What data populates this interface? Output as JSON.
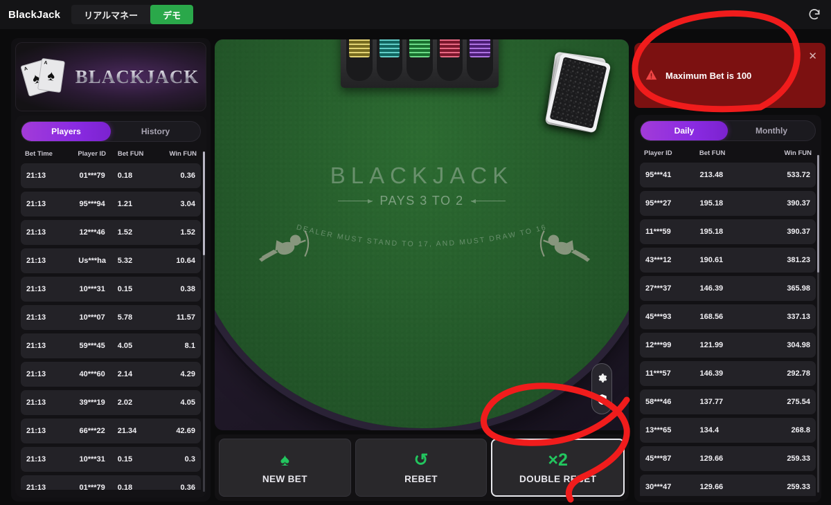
{
  "topbar": {
    "brand": "BlackJack",
    "mode_real_label": "リアルマネー",
    "mode_demo_label": "デモ",
    "refresh_icon": "refresh-icon"
  },
  "logo": {
    "word_black": "B",
    "word_black_rest": "LACK",
    "word_jack": "J",
    "word_jack_rest": "ACK",
    "full": "BLACKJACK"
  },
  "alert": {
    "message": "Maximum Bet is 100",
    "warning_icon": "warning-triangle-icon",
    "close_icon": "close-icon",
    "bg_color": "#7c1111"
  },
  "players_panel": {
    "tabs": [
      {
        "label": "Players",
        "active": true
      },
      {
        "label": "History",
        "active": false
      }
    ],
    "columns": [
      "Bet Time",
      "Player ID",
      "Bet FUN",
      "Win FUN"
    ],
    "rows": [
      {
        "time": "21:13",
        "player": "01***79",
        "bet": "0.18",
        "win": "0.36"
      },
      {
        "time": "21:13",
        "player": "95***94",
        "bet": "1.21",
        "win": "3.04"
      },
      {
        "time": "21:13",
        "player": "12***46",
        "bet": "1.52",
        "win": "1.52"
      },
      {
        "time": "21:13",
        "player": "Us***ha",
        "bet": "5.32",
        "win": "10.64"
      },
      {
        "time": "21:13",
        "player": "10***31",
        "bet": "0.15",
        "win": "0.38"
      },
      {
        "time": "21:13",
        "player": "10***07",
        "bet": "5.78",
        "win": "11.57"
      },
      {
        "time": "21:13",
        "player": "59***45",
        "bet": "4.05",
        "win": "8.1"
      },
      {
        "time": "21:13",
        "player": "40***60",
        "bet": "2.14",
        "win": "4.29"
      },
      {
        "time": "21:13",
        "player": "39***19",
        "bet": "2.02",
        "win": "4.05"
      },
      {
        "time": "21:13",
        "player": "66***22",
        "bet": "21.34",
        "win": "42.69"
      },
      {
        "time": "21:13",
        "player": "10***31",
        "bet": "0.15",
        "win": "0.3"
      },
      {
        "time": "21:13",
        "player": "01***79",
        "bet": "0.18",
        "win": "0.36"
      }
    ]
  },
  "leaderboard_panel": {
    "tabs": [
      {
        "label": "Daily",
        "active": true
      },
      {
        "label": "Monthly",
        "active": false
      }
    ],
    "columns": [
      "Player ID",
      "Bet FUN",
      "Win FUN"
    ],
    "rows": [
      {
        "player": "95***41",
        "bet": "213.48",
        "win": "533.72"
      },
      {
        "player": "95***27",
        "bet": "195.18",
        "win": "390.37"
      },
      {
        "player": "11***59",
        "bet": "195.18",
        "win": "390.37"
      },
      {
        "player": "43***12",
        "bet": "190.61",
        "win": "381.23"
      },
      {
        "player": "27***37",
        "bet": "146.39",
        "win": "365.98"
      },
      {
        "player": "45***93",
        "bet": "168.56",
        "win": "337.13"
      },
      {
        "player": "12***99",
        "bet": "121.99",
        "win": "304.98"
      },
      {
        "player": "11***57",
        "bet": "146.39",
        "win": "292.78"
      },
      {
        "player": "58***46",
        "bet": "137.77",
        "win": "275.54"
      },
      {
        "player": "13***65",
        "bet": "134.4",
        "win": "268.8"
      },
      {
        "player": "45***87",
        "bet": "129.66",
        "win": "259.33"
      },
      {
        "player": "30***47",
        "bet": "129.66",
        "win": "259.33"
      }
    ]
  },
  "table": {
    "title": "BLACKJACK",
    "pays": "PAYS 3 TO 2",
    "rule": "DEALER MUST STAND TO 17, AND MUST DRAW TO 16",
    "felt_color": "#2a6430",
    "chip_colors": [
      "#d8c23a",
      "#1fb9b0",
      "#2ecc55",
      "#e0294f",
      "#8b37d6"
    ]
  },
  "side_controls": {
    "settings_icon": "gear-icon",
    "verified_icon": "shield-check-icon"
  },
  "actions": [
    {
      "glyph": "♠",
      "glyph_name": "spade-icon",
      "label": "NEW BET",
      "selected": false
    },
    {
      "glyph": "↺",
      "glyph_name": "refresh-icon",
      "label": "REBET",
      "selected": false
    },
    {
      "glyph": "×2",
      "glyph_name": "multiply-two-icon",
      "label": "DOUBLE REBET",
      "selected": true
    }
  ],
  "annotations": {
    "color": "#f01c1c",
    "shapes": [
      "circle-around-alert",
      "circle-around-double-rebet"
    ]
  }
}
